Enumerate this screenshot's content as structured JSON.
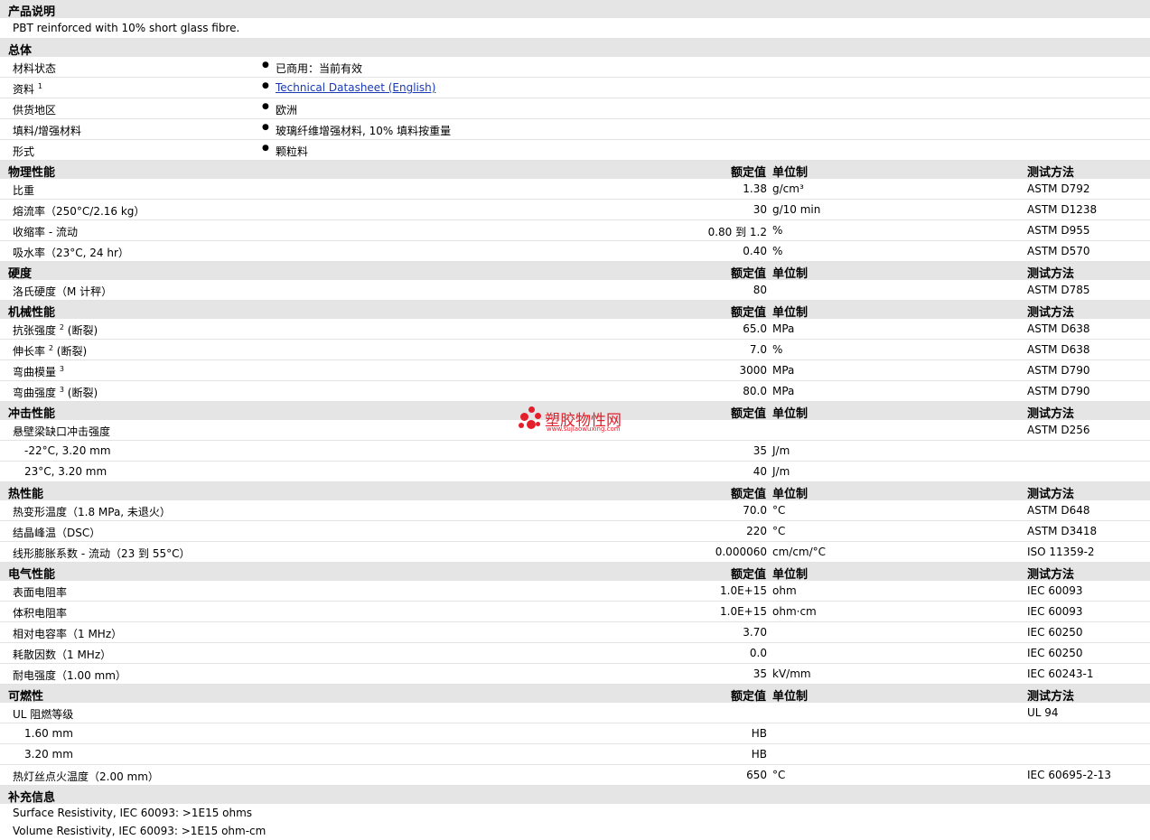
{
  "description": {
    "title": "产品说明",
    "text": "PBT reinforced with 10% short glass fibre."
  },
  "general": {
    "title": "总体",
    "rows": [
      {
        "label": "材料状态",
        "value": "已商用：当前有效"
      },
      {
        "label": "资料",
        "sup": "1",
        "value": "Technical Datasheet (English)"
      },
      {
        "label": "供货地区",
        "value": "欧洲"
      },
      {
        "label": "填料/增强材料",
        "value": "玻璃纤维增强材料, 10% 填料按重量"
      },
      {
        "label": "形式",
        "value": "颗粒料"
      }
    ]
  },
  "columns": {
    "value": "额定值",
    "unit": "单位制",
    "method": "测试方法"
  },
  "physical": {
    "title": "物理性能",
    "rows": [
      {
        "label": "比重",
        "value": "1.38",
        "unit": "g/cm³",
        "method": "ASTM D792"
      },
      {
        "label": "熔流率（250°C/2.16 kg）",
        "value": "30",
        "unit": "g/10 min",
        "method": "ASTM D1238"
      },
      {
        "label": "收缩率 - 流动",
        "value": "0.80 到 1.2",
        "unit": "%",
        "method": "ASTM D955"
      },
      {
        "label": "吸水率（23°C, 24 hr）",
        "value": "0.40",
        "unit": "%",
        "method": "ASTM D570"
      }
    ]
  },
  "hardness": {
    "title": "硬度",
    "rows": [
      {
        "label": "洛氏硬度（M 计秤）",
        "value": "80",
        "unit": "",
        "method": "ASTM D785"
      }
    ]
  },
  "mechanical": {
    "title": "机械性能",
    "rows": [
      {
        "label": "抗张强度",
        "sup": "2",
        "suffix": "(断裂)",
        "value": "65.0",
        "unit": "MPa",
        "method": "ASTM D638"
      },
      {
        "label": "伸长率",
        "sup": "2",
        "suffix": "(断裂)",
        "value": "7.0",
        "unit": "%",
        "method": "ASTM D638"
      },
      {
        "label": "弯曲模量",
        "sup": "3",
        "suffix": "",
        "value": "3000",
        "unit": "MPa",
        "method": "ASTM D790"
      },
      {
        "label": "弯曲强度",
        "sup": "3",
        "suffix": "(断裂)",
        "value": "80.0",
        "unit": "MPa",
        "method": "ASTM D790"
      }
    ]
  },
  "impact": {
    "title": "冲击性能",
    "rows": [
      {
        "label": "悬壁梁缺口冲击强度",
        "value": "",
        "unit": "",
        "method": "ASTM D256"
      },
      {
        "label": "-22°C, 3.20 mm",
        "indent": true,
        "value": "35",
        "unit": "J/m",
        "method": ""
      },
      {
        "label": "23°C, 3.20 mm",
        "indent": true,
        "value": "40",
        "unit": "J/m",
        "method": ""
      }
    ]
  },
  "thermal": {
    "title": "热性能",
    "rows": [
      {
        "label": "热变形温度（1.8 MPa, 未退火）",
        "value": "70.0",
        "unit": "°C",
        "method": "ASTM D648"
      },
      {
        "label": "结晶峰温（DSC）",
        "value": "220",
        "unit": "°C",
        "method": "ASTM D3418"
      },
      {
        "label": "线形膨胀系数 - 流动（23 到 55°C）",
        "value": "0.000060",
        "unit": "cm/cm/°C",
        "method": "ISO 11359-2"
      }
    ]
  },
  "electrical": {
    "title": "电气性能",
    "rows": [
      {
        "label": "表面电阻率",
        "value": "1.0E+15",
        "unit": "ohm",
        "method": "IEC 60093"
      },
      {
        "label": "体积电阻率",
        "value": "1.0E+15",
        "unit": "ohm·cm",
        "method": "IEC 60093"
      },
      {
        "label": "相对电容率（1 MHz）",
        "value": "3.70",
        "unit": "",
        "method": "IEC 60250"
      },
      {
        "label": "耗散因数（1 MHz）",
        "value": "0.0",
        "unit": "",
        "method": "IEC 60250"
      },
      {
        "label": "耐电强度（1.00 mm）",
        "value": "35",
        "unit": "kV/mm",
        "method": "IEC 60243-1"
      }
    ]
  },
  "flammability": {
    "title": "可燃性",
    "rows": [
      {
        "label": "UL 阻燃等级",
        "value": "",
        "unit": "",
        "method": "UL 94"
      },
      {
        "label": "1.60 mm",
        "indent": true,
        "value": "HB",
        "unit": "",
        "method": ""
      },
      {
        "label": "3.20 mm",
        "indent": true,
        "value": "HB",
        "unit": "",
        "method": ""
      },
      {
        "label": "热灯丝点火温度（2.00 mm）",
        "value": "650",
        "unit": "°C",
        "method": "IEC 60695-2-13"
      }
    ]
  },
  "supplement": {
    "title": "补充信息",
    "lines": [
      "Surface Resistivity, IEC 60093: >1E15 ohms",
      "Volume Resistivity, IEC 60093: >1E15 ohm-cm"
    ]
  },
  "watermark": {
    "name": "塑胶物性网",
    "url": "www.sujiaowuxing.com",
    "color": "#e41e2a"
  }
}
